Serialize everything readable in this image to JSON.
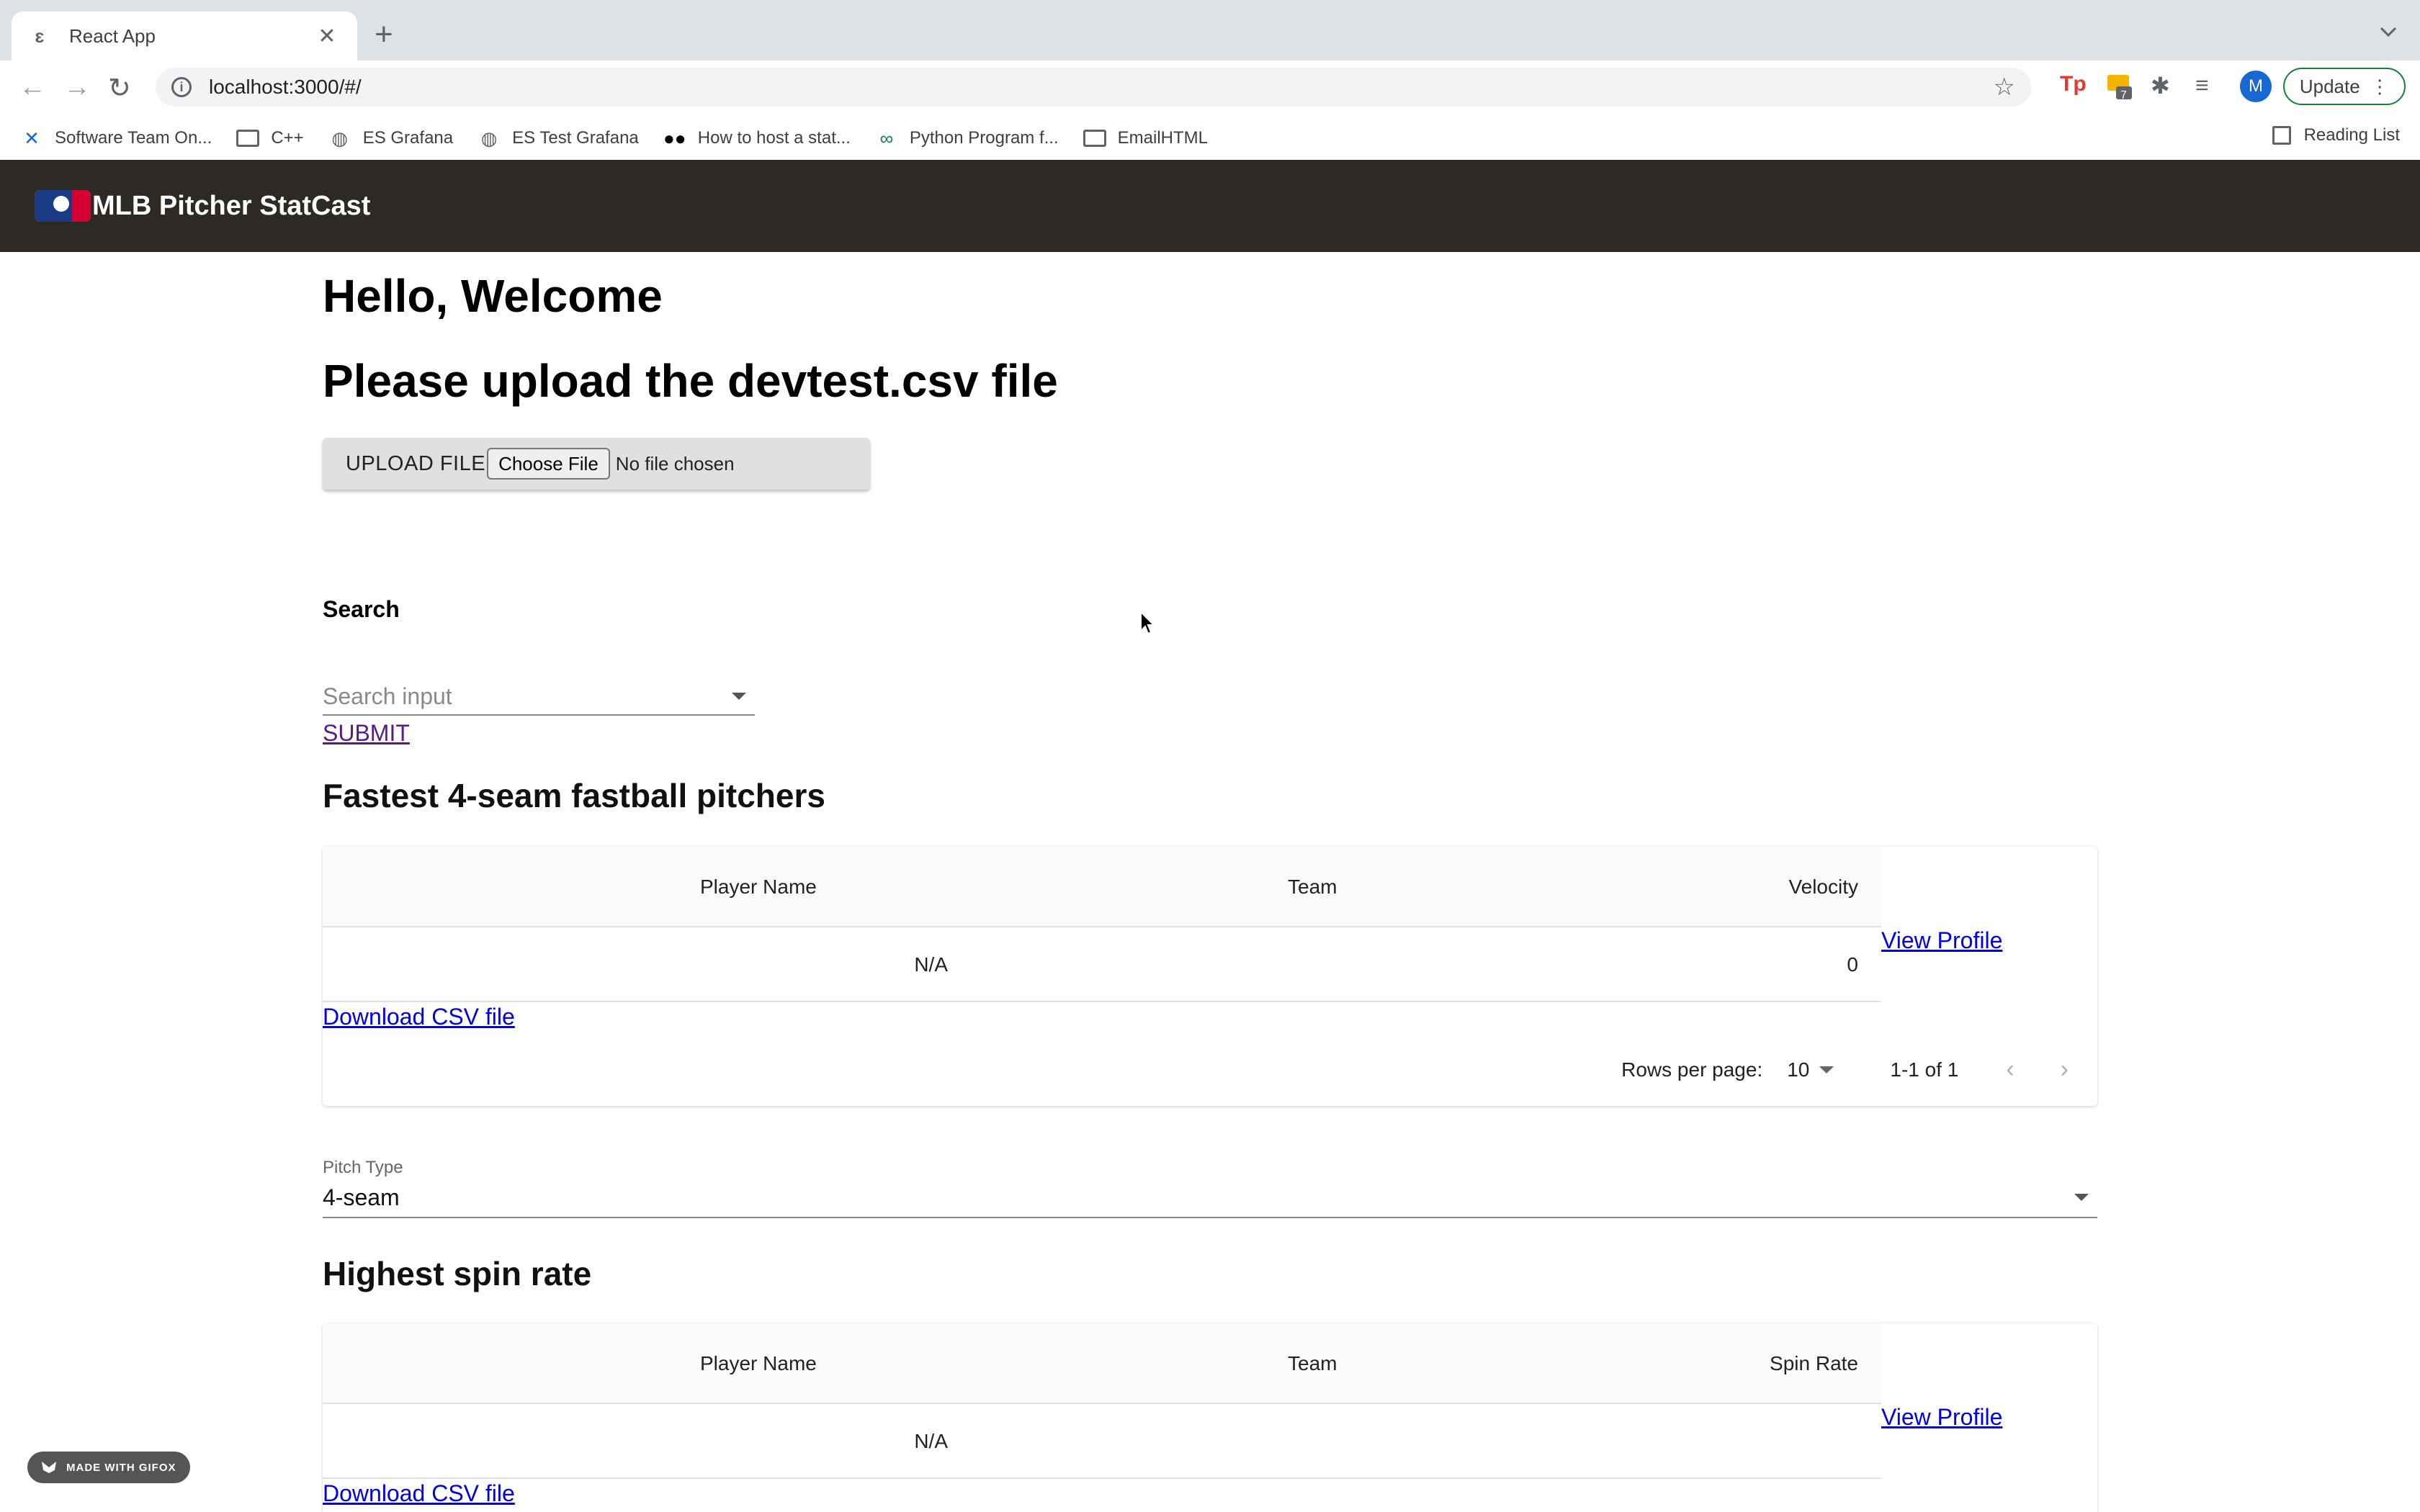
{
  "browser": {
    "tab_title": "React App",
    "url": "localhost:3000/#/",
    "update_label": "Update",
    "profile_initial": "M",
    "extension_badge": "7",
    "extension_tp": "Tp",
    "bookmarks": [
      {
        "label": "Software Team On...",
        "icon": "confluence-icon"
      },
      {
        "label": "C++",
        "icon": "folder-icon"
      },
      {
        "label": "ES Grafana",
        "icon": "globe-icon"
      },
      {
        "label": "ES Test Grafana",
        "icon": "globe-icon"
      },
      {
        "label": "How to host a stat...",
        "icon": "medium-icon"
      },
      {
        "label": "Python Program f...",
        "icon": "link-icon"
      },
      {
        "label": "EmailHTML",
        "icon": "folder-icon"
      }
    ],
    "reading_list": "Reading List"
  },
  "app": {
    "brand": "MLB Pitcher StatCast",
    "colors": {
      "appbar": "#2d2924",
      "logo_blue": "#1b3a84",
      "logo_red": "#d50032",
      "link": "#0000ee",
      "visited_link": "#551a8b"
    }
  },
  "main": {
    "greeting": "Hello, Welcome",
    "upload_prompt": "Please upload the devtest.csv file",
    "upload_button": "UPLOAD FILE",
    "choose_file": "Choose File",
    "no_file": "No file chosen",
    "search_label": "Search",
    "search_placeholder": "Search input",
    "submit": "SUBMIT"
  },
  "fastest": {
    "title": "Fastest 4-seam fastball pitchers",
    "columns": [
      "Player Name",
      "Team",
      "Velocity"
    ],
    "rows": [
      {
        "player": "",
        "team": "N/A",
        "value": "0"
      }
    ],
    "view_profile": "View Profile",
    "download": "Download CSV file",
    "rows_per_page_label": "Rows per page:",
    "rows_per_page": "10",
    "range": "1-1 of 1"
  },
  "pitch_type": {
    "label": "Pitch Type",
    "value": "4-seam"
  },
  "spin": {
    "title": "Highest spin rate",
    "columns": [
      "Player Name",
      "Team",
      "Spin Rate"
    ],
    "rows": [
      {
        "player": "",
        "team": "N/A",
        "value": ""
      }
    ],
    "view_profile": "View Profile",
    "download": "Download CSV file"
  },
  "watermark": "MADE WITH GIFOX"
}
